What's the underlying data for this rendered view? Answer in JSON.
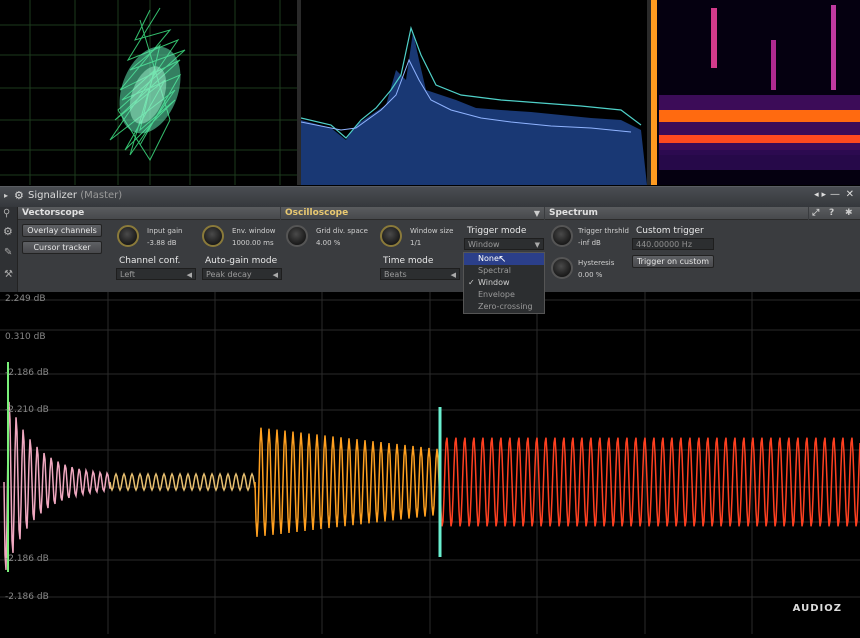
{
  "window": {
    "title": "Signalizer",
    "subtitle": "(Master)"
  },
  "sections": {
    "vectorscope": "Vectorscope",
    "oscilloscope": "Oscilloscope",
    "spectrum": "Spectrum"
  },
  "vectorscope": {
    "overlay_channels": "Overlay channels",
    "cursor_tracker": "Cursor tracker",
    "input_gain_label": "Input gain",
    "input_gain_value": "-3.88 dB",
    "env_window_label": "Env. window",
    "env_window_value": "1000.00 ms",
    "channel_conf_label": "Channel conf.",
    "channel_conf_value": "Left",
    "auto_gain_label": "Auto-gain mode",
    "auto_gain_value": "Peak decay"
  },
  "oscilloscope": {
    "grid_div_label": "Grid div. space",
    "grid_div_value": "4.00 %",
    "window_size_label": "Window size",
    "window_size_value": "1/1",
    "time_mode_label": "Time mode",
    "time_mode_value": "Beats",
    "trigger_mode_label": "Trigger mode",
    "trigger_mode_value": "Window",
    "trigger_options": [
      "None",
      "Spectral",
      "Window",
      "Envelope",
      "Zero-crossing"
    ],
    "trigger_highlighted": "None",
    "trigger_checked": "Window",
    "trigger_thrshld_label": "Trigger thrshld",
    "trigger_thrshld_value": "-inf dB",
    "hysteresis_label": "Hysteresis",
    "hysteresis_value": "0.00 %",
    "custom_trigger_label": "Custom trigger",
    "custom_trigger_value": "440.00000 Hz",
    "trigger_on_custom": "Trigger on custom"
  },
  "scope_labels": [
    "2.249 dB",
    "0.310 dB",
    "-2.186 dB",
    "-2.210 dB",
    "-2.186 dB",
    "-2.186 dB"
  ],
  "watermark": "AUDIOZ",
  "colors": {
    "accent_menu": "#2b3f8a",
    "knob_ring": "#8a7a3a"
  }
}
